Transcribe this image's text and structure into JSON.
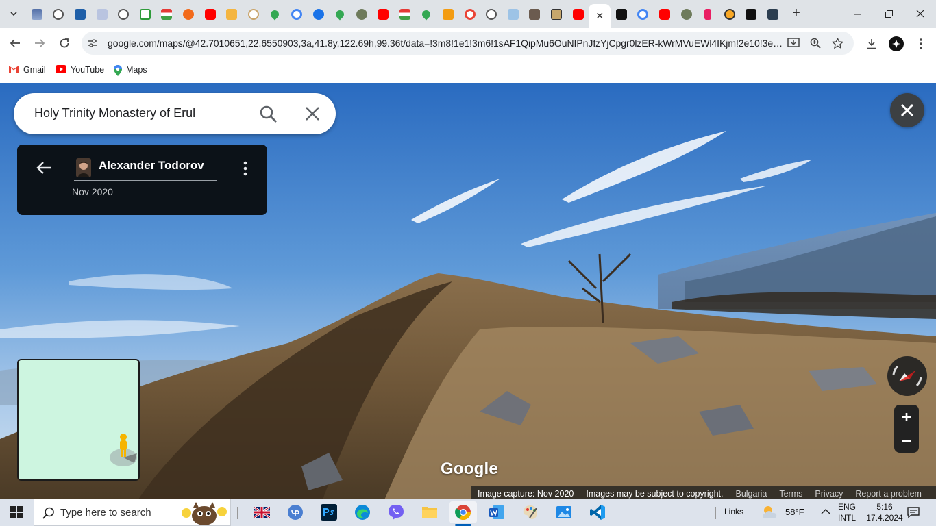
{
  "browser": {
    "active_tab_close": "✕",
    "new_tab": "+",
    "url": "google.com/maps/@42.7010651,22.6550903,3a,41.8y,122.69h,99.36t/data=!3m8!1e1!3m6!1sAF1QipMu6OuNIPnJfzYjCpgr0lzER-kWrMVuEWl4IKjm!2e10!3e11!...",
    "bookmarks": [
      {
        "label": "Gmail"
      },
      {
        "label": "YouTube"
      },
      {
        "label": "Maps"
      }
    ]
  },
  "maps": {
    "search": {
      "value": "Holy Trinity Monastery of Erul"
    },
    "contributor": {
      "name": "Alexander Todorov",
      "date": "Nov 2020"
    },
    "logo": "Google",
    "footer": {
      "capture": "Image capture: Nov 2020",
      "copyright": "Images may be subject to copyright.",
      "country": "Bulgaria",
      "terms": "Terms",
      "privacy": "Privacy",
      "report": "Report a problem"
    }
  },
  "taskbar": {
    "search_placeholder": "Type here to search",
    "links": "Links",
    "weather": "58°F",
    "lang_top": "ENG",
    "lang_bottom": "INTL",
    "time": "5:16",
    "date": "17.4.2024"
  },
  "colors": {
    "accent": "#1a73e8",
    "minimap": "#cdf5e0",
    "card": "#0c1218"
  }
}
